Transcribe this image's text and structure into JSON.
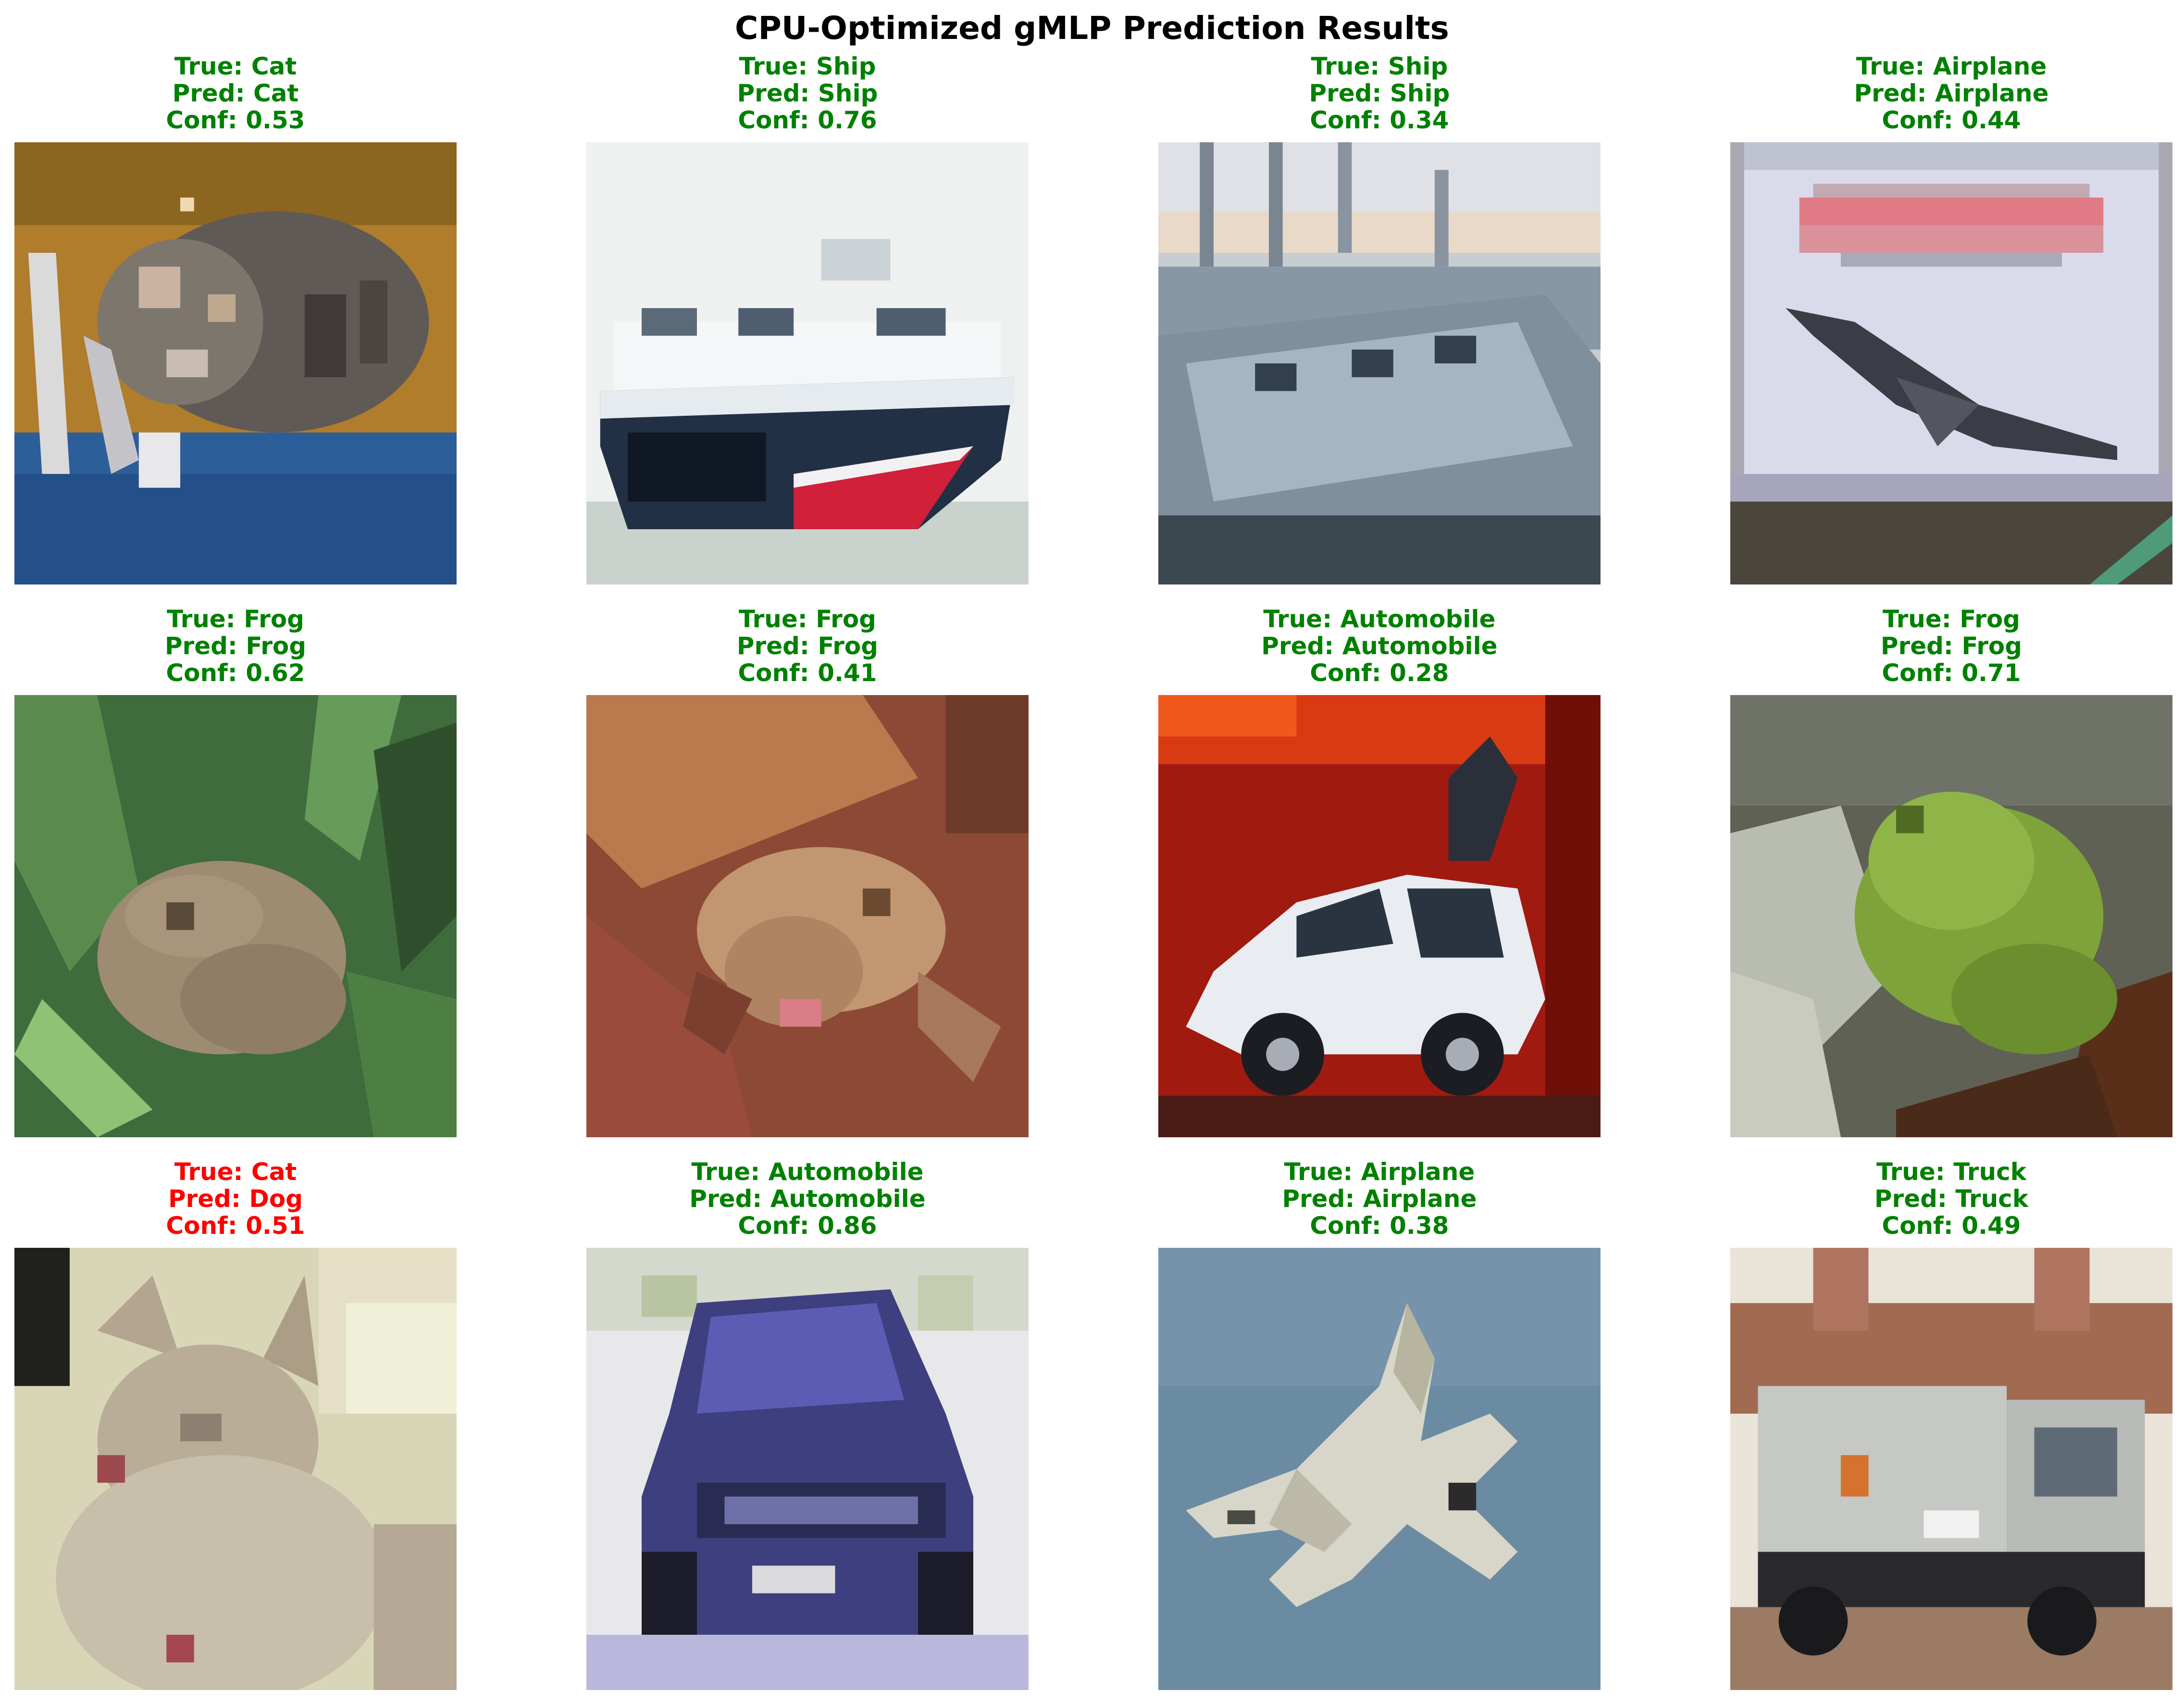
{
  "figure": {
    "title": "CPU-Optimized gMLP Prediction Results"
  },
  "panels": [
    {
      "true_label": "True: Cat",
      "pred_label": "Pred: Cat",
      "conf_label": "Conf: 0.53",
      "correct": true,
      "subject": "cat"
    },
    {
      "true_label": "True: Ship",
      "pred_label": "Pred: Ship",
      "conf_label": "Conf: 0.76",
      "correct": true,
      "subject": "ship"
    },
    {
      "true_label": "True: Ship",
      "pred_label": "Pred: Ship",
      "conf_label": "Conf: 0.34",
      "correct": true,
      "subject": "ship"
    },
    {
      "true_label": "True: Airplane",
      "pred_label": "Pred: Airplane",
      "conf_label": "Conf: 0.44",
      "correct": true,
      "subject": "airplane"
    },
    {
      "true_label": "True: Frog",
      "pred_label": "Pred: Frog",
      "conf_label": "Conf: 0.62",
      "correct": true,
      "subject": "frog"
    },
    {
      "true_label": "True: Frog",
      "pred_label": "Pred: Frog",
      "conf_label": "Conf: 0.41",
      "correct": true,
      "subject": "frog"
    },
    {
      "true_label": "True: Automobile",
      "pred_label": "Pred: Automobile",
      "conf_label": "Conf: 0.28",
      "correct": true,
      "subject": "automobile"
    },
    {
      "true_label": "True: Frog",
      "pred_label": "Pred: Frog",
      "conf_label": "Conf: 0.71",
      "correct": true,
      "subject": "frog"
    },
    {
      "true_label": "True: Cat",
      "pred_label": "Pred: Dog",
      "conf_label": "Conf: 0.51",
      "correct": false,
      "subject": "cat"
    },
    {
      "true_label": "True: Automobile",
      "pred_label": "Pred: Automobile",
      "conf_label": "Conf: 0.86",
      "correct": true,
      "subject": "automobile"
    },
    {
      "true_label": "True: Airplane",
      "pred_label": "Pred: Airplane",
      "conf_label": "Conf: 0.38",
      "correct": true,
      "subject": "airplane"
    },
    {
      "true_label": "True: Truck",
      "pred_label": "Pred: Truck",
      "conf_label": "Conf: 0.49",
      "correct": true,
      "subject": "truck"
    }
  ],
  "colors": {
    "correct": "#008000",
    "wrong": "#ff0000"
  }
}
